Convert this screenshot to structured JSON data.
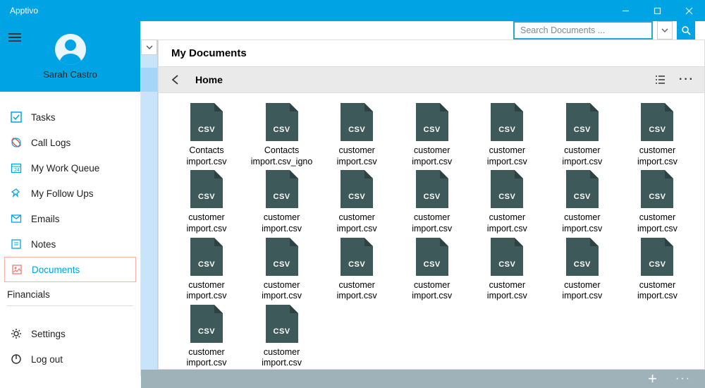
{
  "window": {
    "title": "Apptivo"
  },
  "search": {
    "placeholder": "Search Documents ..."
  },
  "user": {
    "name": "Sarah Castro"
  },
  "sidebar": {
    "items": [
      {
        "label": "Tasks"
      },
      {
        "label": "Call Logs"
      },
      {
        "label": "My Work Queue"
      },
      {
        "label": "My Follow Ups"
      },
      {
        "label": "Emails"
      },
      {
        "label": "Notes"
      },
      {
        "label": "Documents"
      }
    ],
    "section": "Financials",
    "bottom": {
      "settings": "Settings",
      "logout": "Log out"
    }
  },
  "content": {
    "title": "My Documents",
    "breadcrumb": "Home"
  },
  "files": [
    {
      "name": "Contacts import.csv",
      "ext": "CSV"
    },
    {
      "name": "Contacts import.csv_igno",
      "ext": "CSV"
    },
    {
      "name": "customer import.csv",
      "ext": "CSV"
    },
    {
      "name": "customer import.csv",
      "ext": "CSV"
    },
    {
      "name": "customer import.csv",
      "ext": "CSV"
    },
    {
      "name": "customer import.csv",
      "ext": "CSV"
    },
    {
      "name": "customer import.csv",
      "ext": "CSV"
    },
    {
      "name": "customer import.csv",
      "ext": "CSV"
    },
    {
      "name": "customer import.csv",
      "ext": "CSV"
    },
    {
      "name": "customer import.csv",
      "ext": "CSV"
    },
    {
      "name": "customer import.csv",
      "ext": "CSV"
    },
    {
      "name": "customer import.csv",
      "ext": "CSV"
    },
    {
      "name": "customer import.csv",
      "ext": "CSV"
    },
    {
      "name": "customer import.csv",
      "ext": "CSV"
    },
    {
      "name": "customer import.csv",
      "ext": "CSV"
    },
    {
      "name": "customer import.csv",
      "ext": "CSV"
    },
    {
      "name": "customer import.csv",
      "ext": "CSV"
    },
    {
      "name": "customer import.csv",
      "ext": "CSV"
    },
    {
      "name": "customer import.csv",
      "ext": "CSV"
    },
    {
      "name": "customer import.csv",
      "ext": "CSV"
    },
    {
      "name": "customer import.csv",
      "ext": "CSV"
    },
    {
      "name": "customer import.csv",
      "ext": "CSV"
    },
    {
      "name": "customer import.csv",
      "ext": "CSV"
    }
  ]
}
